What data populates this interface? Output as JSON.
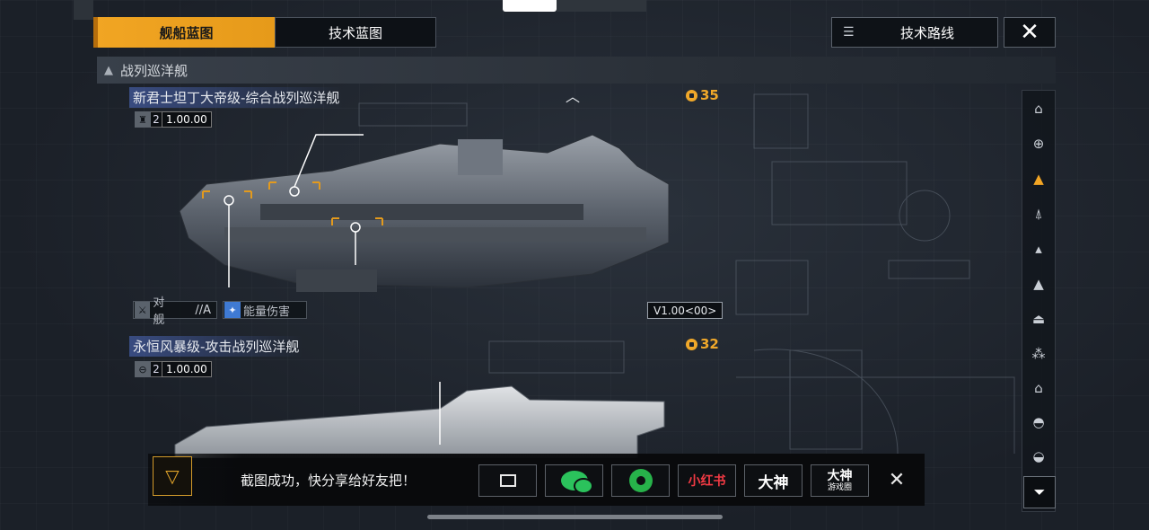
{
  "header": {
    "tabs": [
      {
        "label": "舰船蓝图",
        "active": true
      },
      {
        "label": "技术蓝图",
        "active": false
      }
    ],
    "route_button": "技术路线",
    "close_icon": "close-icon"
  },
  "section": {
    "title": "战列巡洋舰"
  },
  "ships": [
    {
      "name": "新君士坦丁大帝级-综合战列巡洋舰",
      "level": "2",
      "version": "1.00.00",
      "cost": "35",
      "tags": [
        {
          "label": "对舰",
          "grade": "//A"
        },
        {
          "label": "能量伤害"
        }
      ],
      "version_badge": "V1.00<00>"
    },
    {
      "name": "永恒风暴级-攻击战列巡洋舰",
      "level": "2",
      "version": "1.00.00",
      "cost": "32"
    }
  ],
  "sidebar": {
    "items": [
      {
        "icon": "frigate-icon",
        "active": false
      },
      {
        "icon": "destroyer-icon",
        "active": false
      },
      {
        "icon": "cruiser-icon",
        "active": true
      },
      {
        "icon": "battlecruiser-icon",
        "active": false
      },
      {
        "icon": "aux-ship-icon",
        "active": false
      },
      {
        "icon": "carrier-icon",
        "active": false
      },
      {
        "icon": "battleship-icon",
        "active": false
      },
      {
        "icon": "fleet-icon",
        "active": false
      },
      {
        "icon": "station-icon",
        "active": false
      },
      {
        "icon": "dome-icon",
        "active": false
      },
      {
        "icon": "base-icon",
        "active": false
      }
    ],
    "filter_icon": "filter-icon"
  },
  "share": {
    "message": "截图成功，快分享给好友把！",
    "buttons": [
      "screenshot",
      "wechat",
      "moments",
      "小红书",
      "大神",
      "大神"
    ],
    "xiaohongshu_label": "小红书",
    "dashen_label": "大神",
    "dashen_circle_label": "大神",
    "dashen_circle_sub": "游戏圈"
  },
  "colors": {
    "accent": "#f1a523",
    "panel": "#0e1217",
    "background": "#1d232c"
  }
}
